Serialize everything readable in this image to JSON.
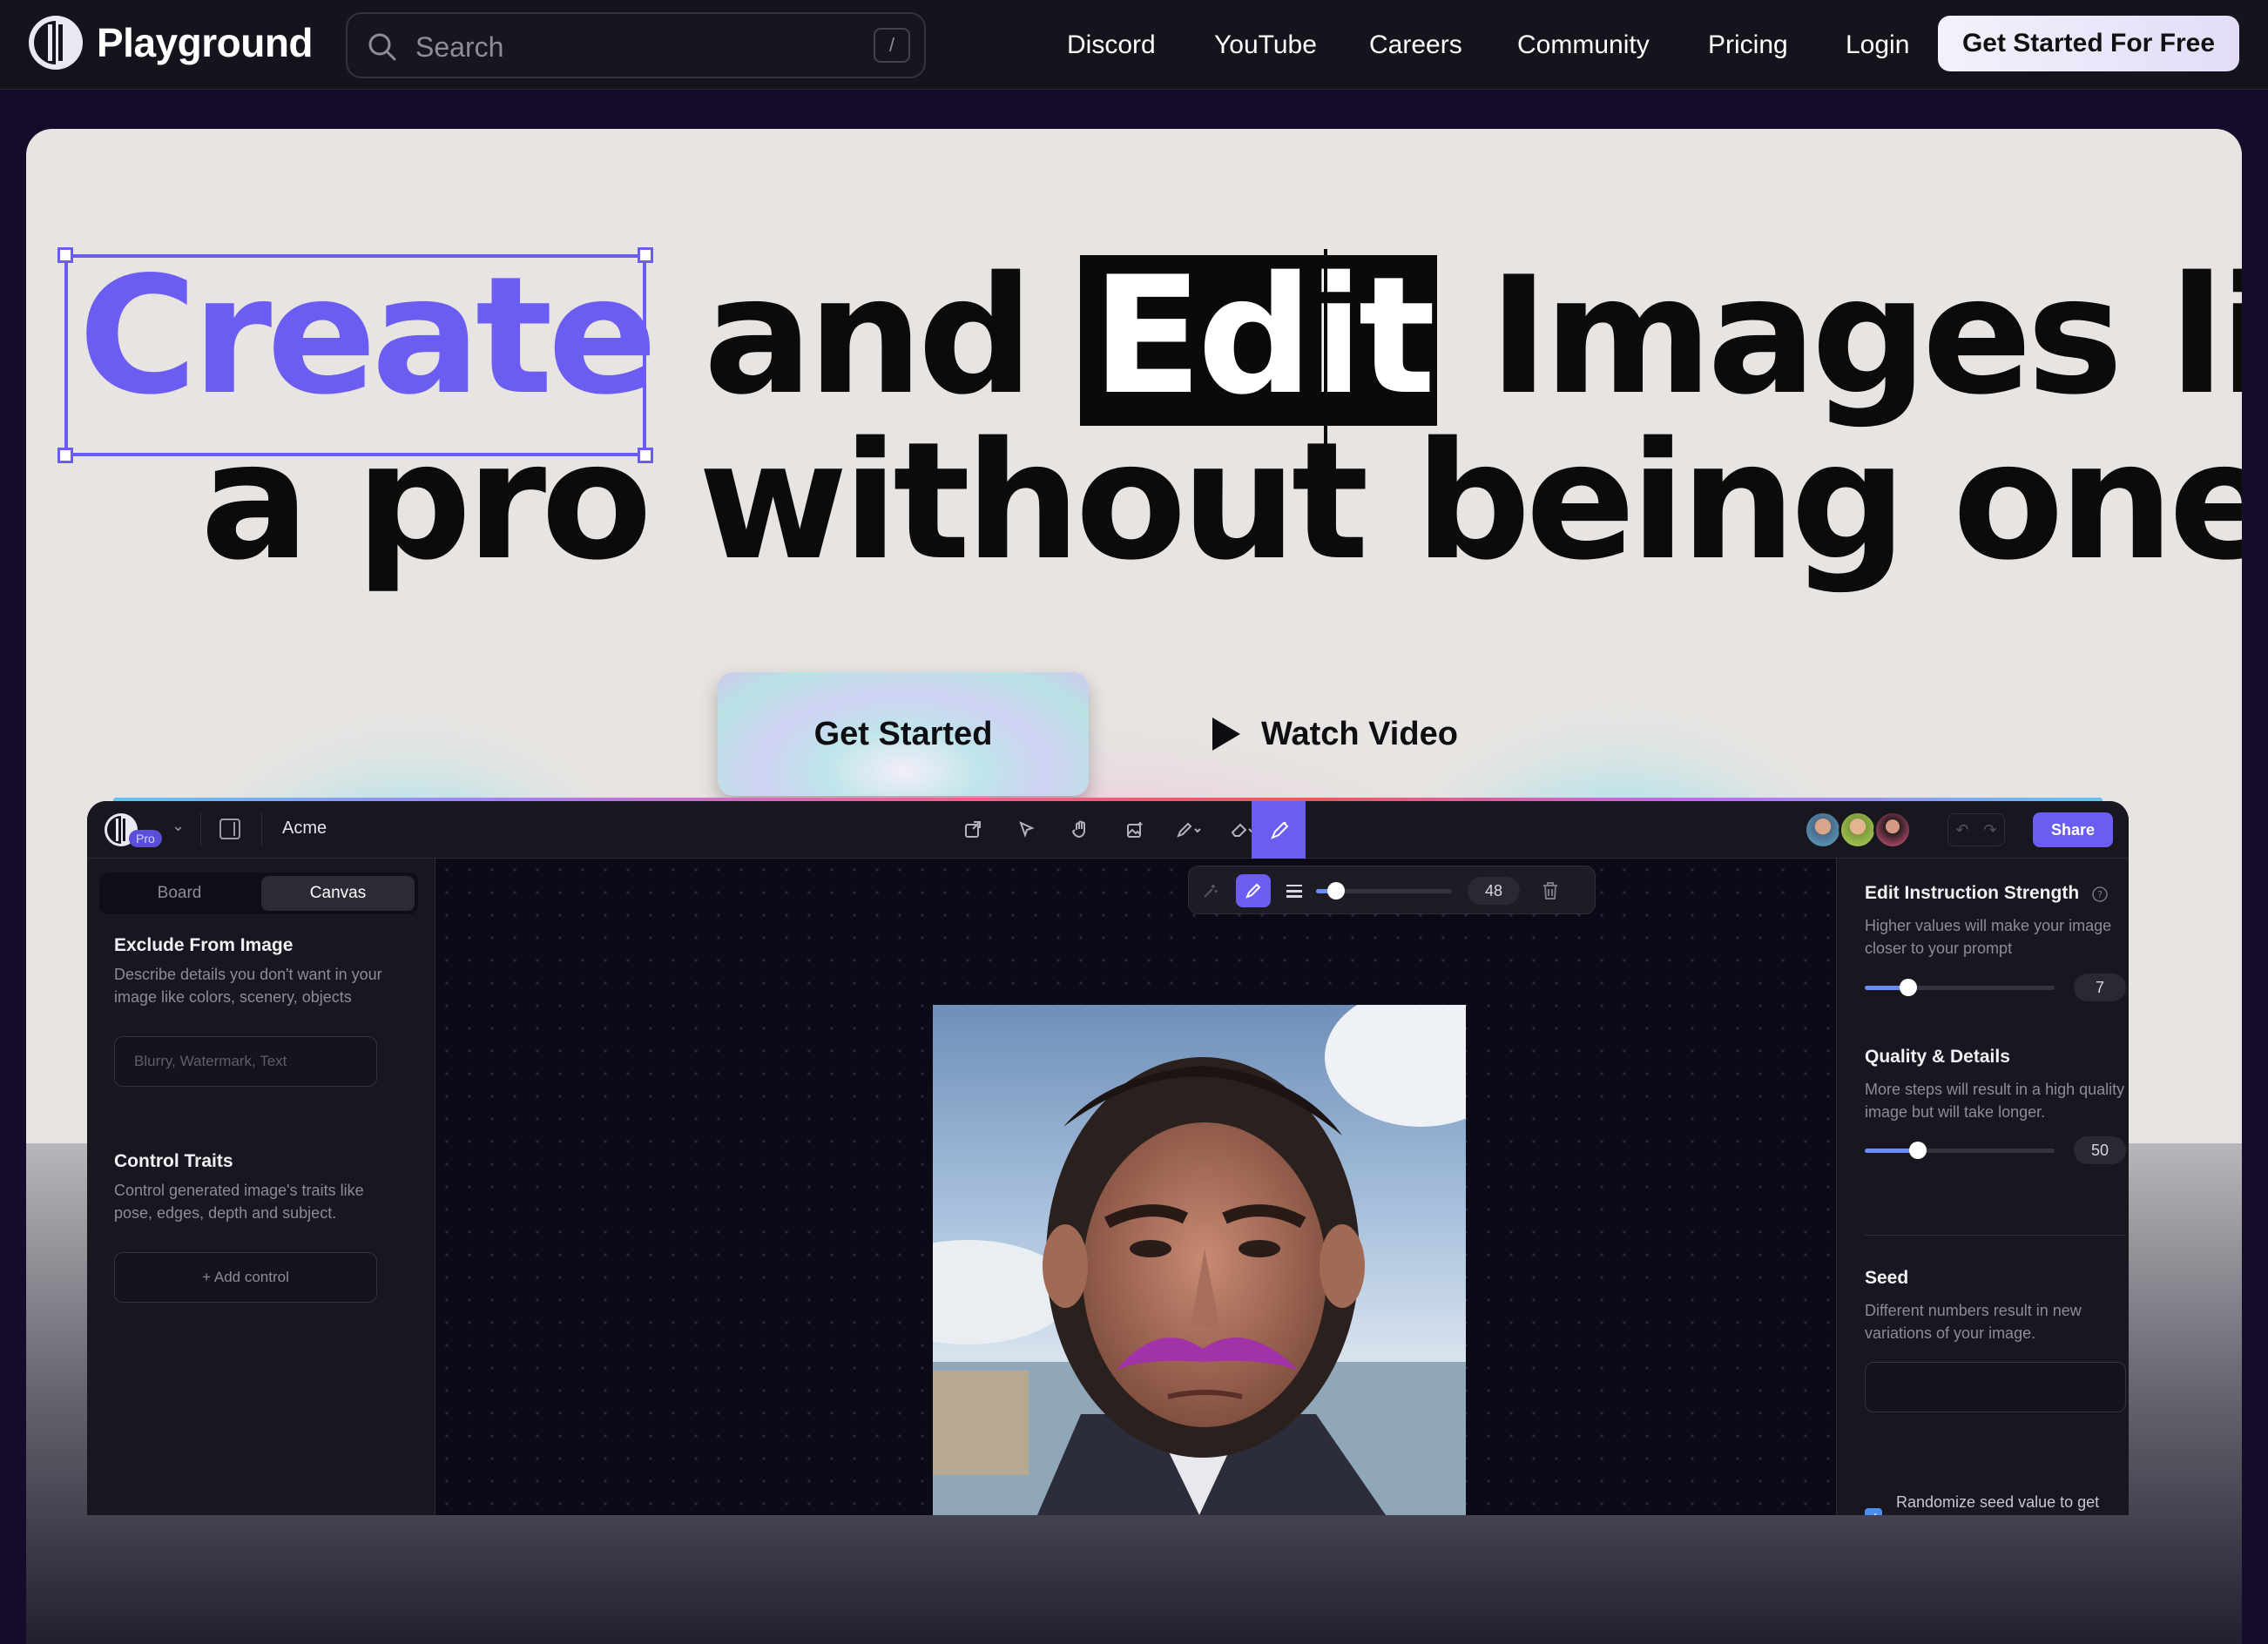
{
  "nav": {
    "brand": "Playground",
    "search_placeholder": "Search",
    "search_shortcut": "/",
    "links": [
      "Discord",
      "YouTube",
      "Careers",
      "Community",
      "Pricing",
      "Login"
    ],
    "cta": "Get Started For Free"
  },
  "hero": {
    "word_create": "Create",
    "word_and": "and",
    "word_edit": "Edit",
    "rest_line1": "Images like",
    "line2": "a pro without being one.",
    "primary_button": "Get Started",
    "secondary_button": "Watch Video"
  },
  "app": {
    "workspace_title": "Acme",
    "pro_badge": "Pro",
    "share": "Share",
    "left": {
      "tabs": [
        "Board",
        "Canvas"
      ],
      "active_tab": "Canvas",
      "exclude_title": "Exclude From Image",
      "exclude_desc": "Describe details you don't want in your image like colors, scenery, objects",
      "exclude_placeholder": "Blurry, Watermark, Text",
      "control_title": "Control Traits",
      "control_desc": "Control generated image's traits like pose, edges, depth and subject.",
      "add_control": "+ Add control"
    },
    "brush": {
      "size": "48",
      "size_fraction": 0.15
    },
    "right": {
      "strength_title": "Edit Instruction Strength",
      "strength_desc": "Higher values will make your image closer to your prompt",
      "strength_value": "7",
      "strength_fraction": 0.23,
      "quality_title": "Quality & Details",
      "quality_desc": "More steps will result in a high quality image but will take longer.",
      "quality_value": "50",
      "quality_fraction": 0.28,
      "seed_title": "Seed",
      "seed_desc": "Different numbers result in new variations of your image.",
      "randomize_label": "Randomize seed value to get new variations"
    }
  },
  "colors": {
    "accent": "#6b5df2",
    "hero_bg": "#e8e4e1",
    "nav_bg": "#15141d"
  }
}
